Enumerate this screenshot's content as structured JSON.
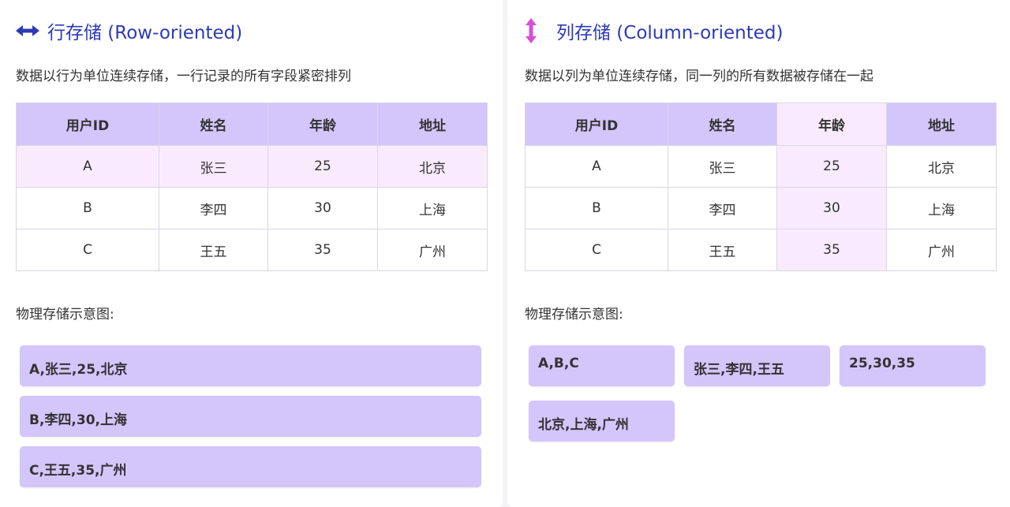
{
  "row_panel": {
    "title": "行存储 (Row-oriented)",
    "icon": "left-right-arrow-icon",
    "description": "数据以行为单位连续存储，一行记录的所有字段紧密排列",
    "table": {
      "headers": [
        "用户ID",
        "姓名",
        "年龄",
        "地址"
      ],
      "rows": [
        [
          "A",
          "张三",
          "25",
          "北京"
        ],
        [
          "B",
          "李四",
          "30",
          "上海"
        ],
        [
          "C",
          "王五",
          "35",
          "广州"
        ]
      ]
    },
    "physical_label": "物理存储示意图:",
    "blocks": [
      "A,张三,25,北京",
      "B,李四,30,上海",
      "C,王五,35,广州"
    ]
  },
  "column_panel": {
    "title": "列存储 (Column-oriented)",
    "icon": "up-down-arrow-icon",
    "description": "数据以列为单位连续存储，同一列的所有数据被存储在一起",
    "table": {
      "headers": [
        "用户ID",
        "姓名",
        "年龄",
        "地址"
      ],
      "rows": [
        [
          "A",
          "张三",
          "25",
          "北京"
        ],
        [
          "B",
          "李四",
          "30",
          "上海"
        ],
        [
          "C",
          "王五",
          "35",
          "广州"
        ]
      ]
    },
    "physical_label": "物理存储示意图:",
    "blocks": [
      "A,B,C",
      "张三,李四,王五",
      "25,30,35",
      "北京,上海,广州"
    ]
  },
  "colors": {
    "title": "#2d3ab5",
    "header_bg": "#d3c6fb",
    "highlight_bg": "#f9ebfd",
    "block_bg": "#d3c6fb",
    "row_icon": "#2d3ab5",
    "column_icon": "#d64fd8"
  }
}
